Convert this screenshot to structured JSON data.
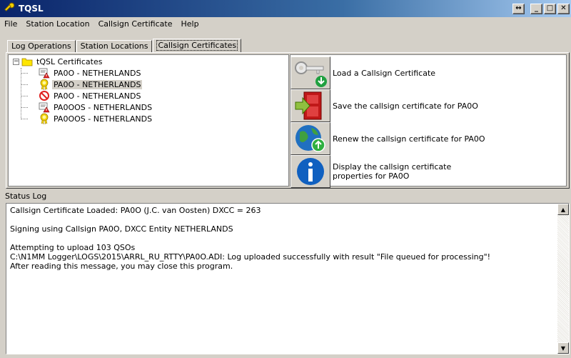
{
  "window": {
    "title": "TQSL"
  },
  "window_buttons": {
    "restore_icon": "↔",
    "minimize_icon": "_",
    "maximize_icon": "□",
    "close_icon": "✕"
  },
  "menu": [
    "File",
    "Station Location",
    "Callsign Certificate",
    "Help"
  ],
  "tabs": [
    "Log Operations",
    "Station Locations",
    "Callsign Certificates"
  ],
  "tree": {
    "root": "tQSL Certificates",
    "expander": "−",
    "items": [
      {
        "label": "PA0O - NETHERLANDS",
        "icon": "certificate-warning-icon"
      },
      {
        "label": "PA0O - NETHERLANDS",
        "icon": "certificate-valid-icon"
      },
      {
        "label": "PA0O - NETHERLANDS",
        "icon": "certificate-revoked-icon"
      },
      {
        "label": "PA0OOS - NETHERLANDS",
        "icon": "certificate-warning-icon"
      },
      {
        "label": "PA0OOS - NETHERLANDS",
        "icon": "certificate-valid-icon"
      }
    ]
  },
  "actions": [
    {
      "label": "Load a Callsign Certificate",
      "icon": "key-icon"
    },
    {
      "label": "Save the callsign certificate for PA0O",
      "icon": "save-door-icon"
    },
    {
      "label": "Renew the callsign certificate for PA0O",
      "icon": "globe-renew-icon"
    },
    {
      "label": "Display the callsign certificate properties for PA0O",
      "icon": "info-icon"
    }
  ],
  "status": {
    "label": "Status Log",
    "lines": [
      "Callsign Certificate Loaded:   PA0O (J.C. van Oosten)  DXCC = 263",
      "",
      "Signing using Callsign PA0O, DXCC Entity NETHERLANDS",
      "",
      "Attempting to upload 103 QSOs",
      "C:\\N1MM Logger\\LOGS\\2015\\ARRL_RU_RTTY\\PA0O.ADI: Log uploaded successfully with result \"File queued for processing\"!",
      "After reading this message, you may close this program."
    ]
  },
  "scrollbar": {
    "up_icon": "▲",
    "down_icon": "▼"
  },
  "colors": {
    "titlebar": "#0a246a",
    "face": "#d4d0c8"
  }
}
